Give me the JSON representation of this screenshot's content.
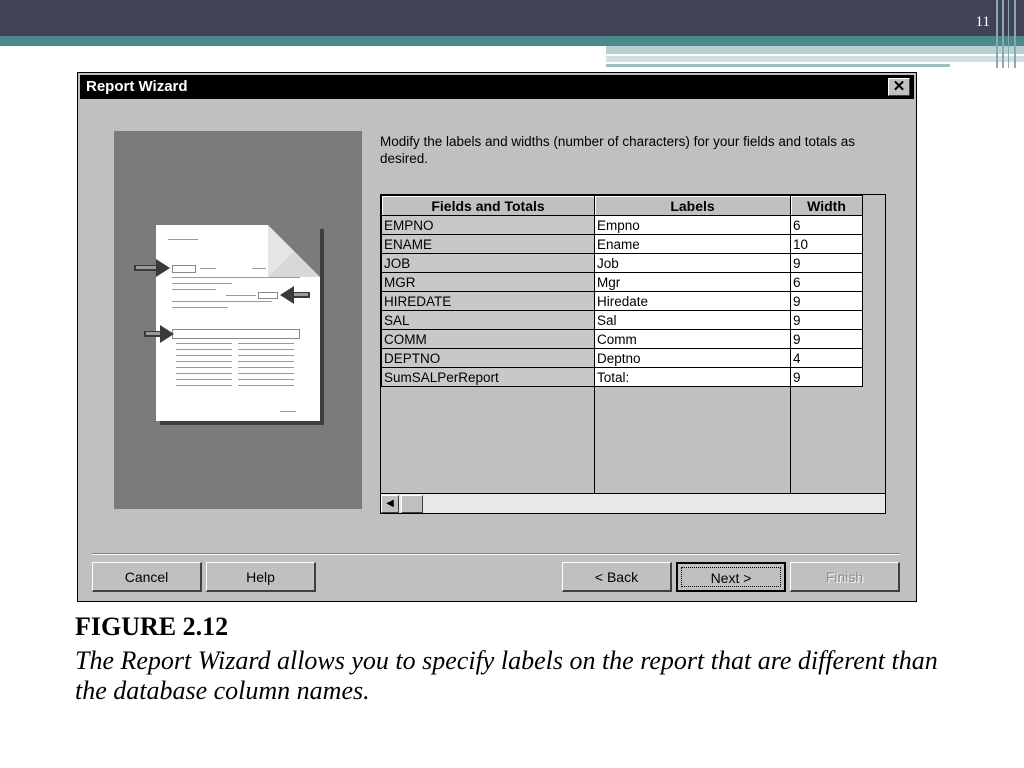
{
  "slide": {
    "number": "11"
  },
  "window": {
    "title": "Report Wizard",
    "close_glyph": "✕"
  },
  "instructions": "Modify the labels and widths (number of characters) for your fields and totals as desired.",
  "grid": {
    "columns": [
      "Fields and Totals",
      "Labels",
      "Width"
    ],
    "rows": [
      [
        "EMPNO",
        "Empno",
        "6"
      ],
      [
        "ENAME",
        "Ename",
        "10"
      ],
      [
        "JOB",
        "Job",
        "9"
      ],
      [
        "MGR",
        "Mgr",
        "6"
      ],
      [
        "HIREDATE",
        "Hiredate",
        "9"
      ],
      [
        "SAL",
        "Sal",
        "9"
      ],
      [
        "COMM",
        "Comm",
        "9"
      ],
      [
        "DEPTNO",
        "Deptno",
        "4"
      ],
      [
        "SumSALPerReport",
        "Total:",
        "9"
      ]
    ]
  },
  "scroll": {
    "up": "▲",
    "down": "▼",
    "left": "◀",
    "right": "▶"
  },
  "buttons": {
    "cancel": "Cancel",
    "help": "Help",
    "back": "< Back",
    "next": "Next >",
    "finish": "Finish"
  },
  "caption": {
    "title": "FIGURE 2.12",
    "text": "The Report Wizard allows you to specify labels on the report that are different than the database column names."
  },
  "colors": {
    "slide_header": "#414256",
    "slide_accent": "#4a8a8d",
    "dialog_face": "#c0c0c0",
    "title_bar": "#000000"
  }
}
